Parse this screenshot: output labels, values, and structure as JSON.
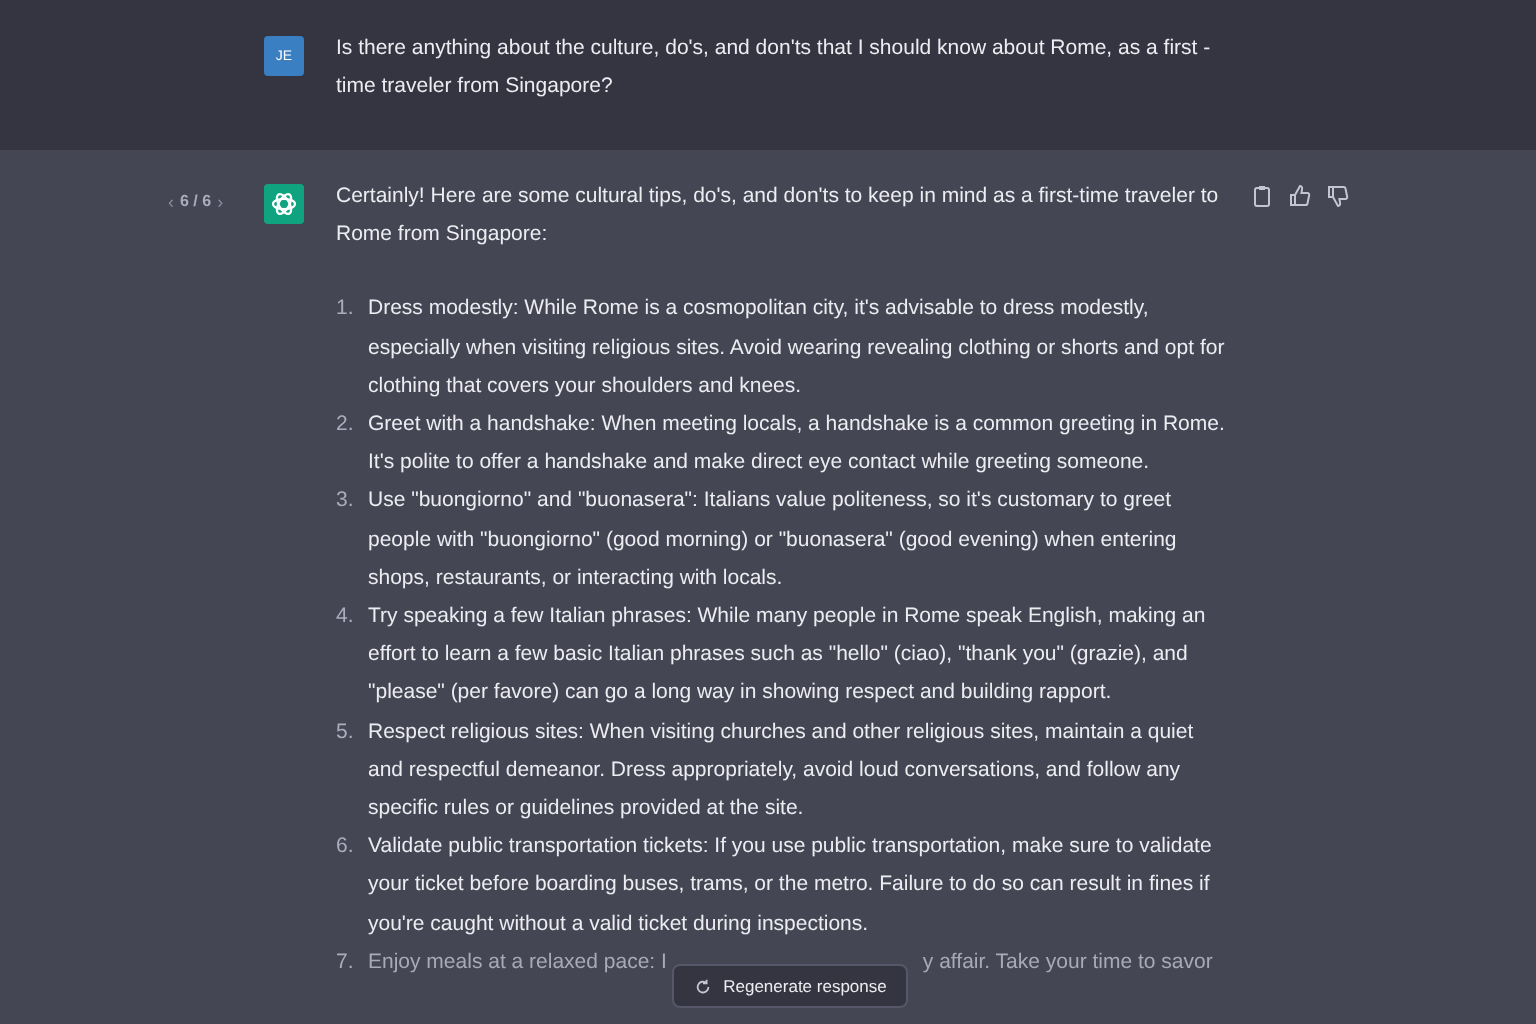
{
  "user_message": {
    "avatar": "JE",
    "text": "Is there anything about the culture, do's, and don'ts that I should know about Rome, as a first -time traveler from Singapore?"
  },
  "assistant_message": {
    "pager": {
      "prev": "‹",
      "count": "6 / 6",
      "next": "›"
    },
    "intro": "Certainly! Here are some cultural tips, do's, and don'ts to keep in mind as a first-time traveler to Rome from Singapore:",
    "items": [
      {
        "number": "1.",
        "text": "Dress modestly: While Rome is a cosmopolitan city, it's advisable to dress modestly, especially when visiting religious sites. Avoid wearing revealing clothing or shorts and opt for clothing that covers your shoulders and knees."
      },
      {
        "number": "2.",
        "text": "Greet with a handshake: When meeting locals, a handshake is a common greeting in Rome. It's polite to offer a handshake and make direct eye contact while greeting someone."
      },
      {
        "number": "3.",
        "text": "Use \"buongiorno\" and \"buonasera\": Italians value politeness, so it's customary to greet people with \"buongiorno\" (good morning) or \"buonasera\" (good evening) when entering shops, restaurants, or interacting with locals."
      },
      {
        "number": "4.",
        "text": "Try speaking a few Italian phrases: While many people in Rome speak English, making an effort to learn a few basic Italian phrases such as \"hello\" (ciao), \"thank you\" (grazie), and \"please\" (per favore) can go a long way in showing respect and building rapport."
      },
      {
        "number": "5.",
        "text": "Respect religious sites: When visiting churches and other religious sites, maintain a quiet and respectful demeanor. Dress appropriately, avoid loud conversations, and follow any specific rules or guidelines provided at the site."
      },
      {
        "number": "6.",
        "text": "Validate public transportation tickets: If you use public transportation, make sure to validate your ticket before boarding buses, trams, or the metro. Failure to do so can result in fines if you're caught without a valid ticket during inspections."
      }
    ],
    "partial_item": {
      "number": "7.",
      "text_before": "Enjoy meals at a relaxed pace: I",
      "text_after": "y affair. Take your time to savor"
    }
  },
  "regenerate_button": {
    "label": "Regenerate response"
  }
}
